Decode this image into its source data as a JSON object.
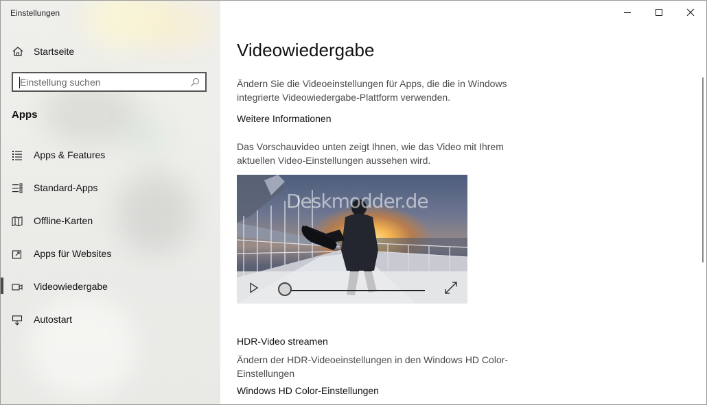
{
  "window": {
    "title": "Einstellungen"
  },
  "sidebar": {
    "home_label": "Startseite",
    "search": {
      "placeholder": "Einstellung suchen",
      "value": ""
    },
    "section_label": "Apps",
    "items": [
      {
        "label": "Apps & Features",
        "icon": "list-icon",
        "active": false
      },
      {
        "label": "Standard-Apps",
        "icon": "default-apps-icon",
        "active": false
      },
      {
        "label": "Offline-Karten",
        "icon": "map-icon",
        "active": false
      },
      {
        "label": "Apps für Websites",
        "icon": "open-in-icon",
        "active": false
      },
      {
        "label": "Videowiedergabe",
        "icon": "video-icon",
        "active": true
      },
      {
        "label": "Autostart",
        "icon": "startup-icon",
        "active": false
      }
    ]
  },
  "main": {
    "title": "Videowiedergabe",
    "description": "Ändern Sie die Videoeinstellungen für Apps, die die in Windows integrierte Videowiedergabe-Plattform verwenden.",
    "more_info_link": "Weitere Informationen",
    "preview_text": "Das Vorschauvideo unten zeigt Ihnen, wie das Video mit Ihrem aktuellen Video-Einstellungen aussehen wird.",
    "video": {
      "watermark": "Deskmodder.de",
      "progress": 0
    },
    "hdr_heading": "HDR-Video streamen",
    "hdr_description": "Ändern der HDR-Videoeinstellungen in den Windows HD Color-Einstellungen",
    "hdr_link": "Windows HD Color-Einstellungen"
  },
  "colors": {
    "sidebar_bg": "#eeeeea",
    "active_indicator": "#4a4a4a",
    "text_primary": "#111111",
    "text_secondary": "#4a4a4a"
  }
}
